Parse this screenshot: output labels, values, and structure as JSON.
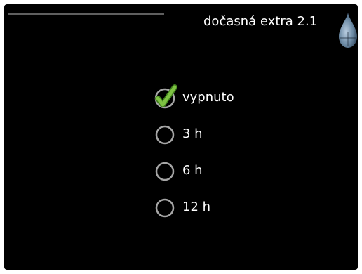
{
  "header": {
    "title": "dočasná extra 2.1",
    "icon": "water-drop-icon"
  },
  "options": [
    {
      "label": "vypnuto",
      "selected": true
    },
    {
      "label": "3 h",
      "selected": false
    },
    {
      "label": "6 h",
      "selected": false
    },
    {
      "label": "12 h",
      "selected": false
    }
  ],
  "colors": {
    "background": "#000000",
    "text": "#ffffff",
    "check": "#76c23a",
    "radio_ring": "#a6a6a6",
    "drop": "#6f8da7"
  }
}
